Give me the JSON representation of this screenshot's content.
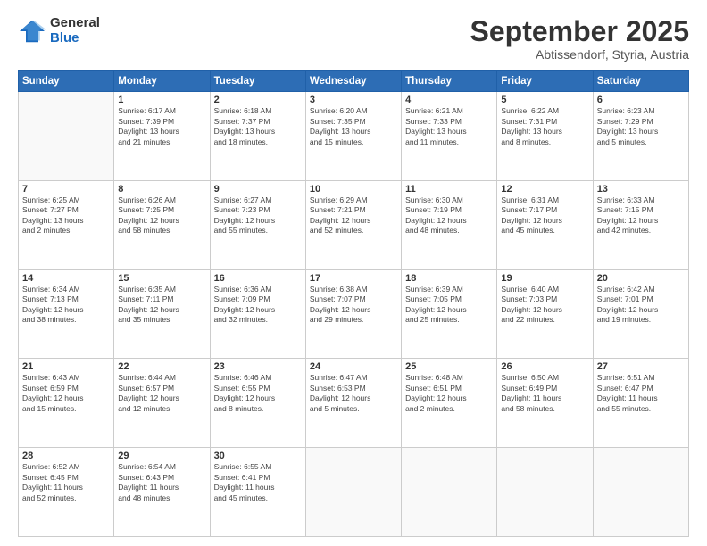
{
  "logo": {
    "general": "General",
    "blue": "Blue"
  },
  "header": {
    "month": "September 2025",
    "location": "Abtissendorf, Styria, Austria"
  },
  "weekdays": [
    "Sunday",
    "Monday",
    "Tuesday",
    "Wednesday",
    "Thursday",
    "Friday",
    "Saturday"
  ],
  "weeks": [
    [
      {
        "day": "",
        "info": ""
      },
      {
        "day": "1",
        "info": "Sunrise: 6:17 AM\nSunset: 7:39 PM\nDaylight: 13 hours\nand 21 minutes."
      },
      {
        "day": "2",
        "info": "Sunrise: 6:18 AM\nSunset: 7:37 PM\nDaylight: 13 hours\nand 18 minutes."
      },
      {
        "day": "3",
        "info": "Sunrise: 6:20 AM\nSunset: 7:35 PM\nDaylight: 13 hours\nand 15 minutes."
      },
      {
        "day": "4",
        "info": "Sunrise: 6:21 AM\nSunset: 7:33 PM\nDaylight: 13 hours\nand 11 minutes."
      },
      {
        "day": "5",
        "info": "Sunrise: 6:22 AM\nSunset: 7:31 PM\nDaylight: 13 hours\nand 8 minutes."
      },
      {
        "day": "6",
        "info": "Sunrise: 6:23 AM\nSunset: 7:29 PM\nDaylight: 13 hours\nand 5 minutes."
      }
    ],
    [
      {
        "day": "7",
        "info": "Sunrise: 6:25 AM\nSunset: 7:27 PM\nDaylight: 13 hours\nand 2 minutes."
      },
      {
        "day": "8",
        "info": "Sunrise: 6:26 AM\nSunset: 7:25 PM\nDaylight: 12 hours\nand 58 minutes."
      },
      {
        "day": "9",
        "info": "Sunrise: 6:27 AM\nSunset: 7:23 PM\nDaylight: 12 hours\nand 55 minutes."
      },
      {
        "day": "10",
        "info": "Sunrise: 6:29 AM\nSunset: 7:21 PM\nDaylight: 12 hours\nand 52 minutes."
      },
      {
        "day": "11",
        "info": "Sunrise: 6:30 AM\nSunset: 7:19 PM\nDaylight: 12 hours\nand 48 minutes."
      },
      {
        "day": "12",
        "info": "Sunrise: 6:31 AM\nSunset: 7:17 PM\nDaylight: 12 hours\nand 45 minutes."
      },
      {
        "day": "13",
        "info": "Sunrise: 6:33 AM\nSunset: 7:15 PM\nDaylight: 12 hours\nand 42 minutes."
      }
    ],
    [
      {
        "day": "14",
        "info": "Sunrise: 6:34 AM\nSunset: 7:13 PM\nDaylight: 12 hours\nand 38 minutes."
      },
      {
        "day": "15",
        "info": "Sunrise: 6:35 AM\nSunset: 7:11 PM\nDaylight: 12 hours\nand 35 minutes."
      },
      {
        "day": "16",
        "info": "Sunrise: 6:36 AM\nSunset: 7:09 PM\nDaylight: 12 hours\nand 32 minutes."
      },
      {
        "day": "17",
        "info": "Sunrise: 6:38 AM\nSunset: 7:07 PM\nDaylight: 12 hours\nand 29 minutes."
      },
      {
        "day": "18",
        "info": "Sunrise: 6:39 AM\nSunset: 7:05 PM\nDaylight: 12 hours\nand 25 minutes."
      },
      {
        "day": "19",
        "info": "Sunrise: 6:40 AM\nSunset: 7:03 PM\nDaylight: 12 hours\nand 22 minutes."
      },
      {
        "day": "20",
        "info": "Sunrise: 6:42 AM\nSunset: 7:01 PM\nDaylight: 12 hours\nand 19 minutes."
      }
    ],
    [
      {
        "day": "21",
        "info": "Sunrise: 6:43 AM\nSunset: 6:59 PM\nDaylight: 12 hours\nand 15 minutes."
      },
      {
        "day": "22",
        "info": "Sunrise: 6:44 AM\nSunset: 6:57 PM\nDaylight: 12 hours\nand 12 minutes."
      },
      {
        "day": "23",
        "info": "Sunrise: 6:46 AM\nSunset: 6:55 PM\nDaylight: 12 hours\nand 8 minutes."
      },
      {
        "day": "24",
        "info": "Sunrise: 6:47 AM\nSunset: 6:53 PM\nDaylight: 12 hours\nand 5 minutes."
      },
      {
        "day": "25",
        "info": "Sunrise: 6:48 AM\nSunset: 6:51 PM\nDaylight: 12 hours\nand 2 minutes."
      },
      {
        "day": "26",
        "info": "Sunrise: 6:50 AM\nSunset: 6:49 PM\nDaylight: 11 hours\nand 58 minutes."
      },
      {
        "day": "27",
        "info": "Sunrise: 6:51 AM\nSunset: 6:47 PM\nDaylight: 11 hours\nand 55 minutes."
      }
    ],
    [
      {
        "day": "28",
        "info": "Sunrise: 6:52 AM\nSunset: 6:45 PM\nDaylight: 11 hours\nand 52 minutes."
      },
      {
        "day": "29",
        "info": "Sunrise: 6:54 AM\nSunset: 6:43 PM\nDaylight: 11 hours\nand 48 minutes."
      },
      {
        "day": "30",
        "info": "Sunrise: 6:55 AM\nSunset: 6:41 PM\nDaylight: 11 hours\nand 45 minutes."
      },
      {
        "day": "",
        "info": ""
      },
      {
        "day": "",
        "info": ""
      },
      {
        "day": "",
        "info": ""
      },
      {
        "day": "",
        "info": ""
      }
    ]
  ]
}
